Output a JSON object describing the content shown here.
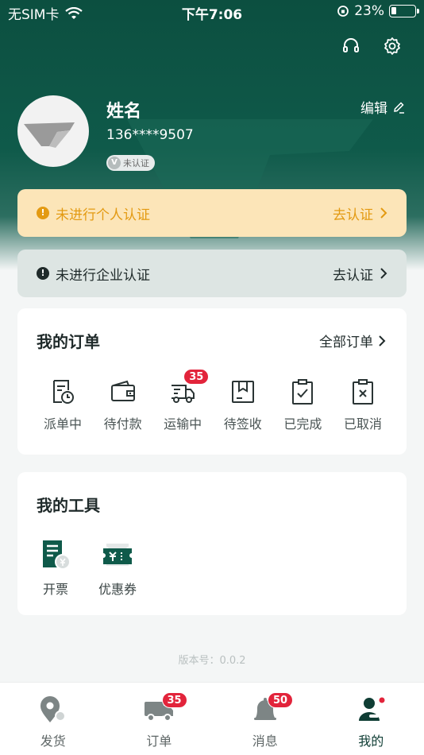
{
  "status_bar": {
    "carrier": "无SIM卡",
    "time": "下午7:06",
    "battery": "23%",
    "battery_level": 0.23
  },
  "profile": {
    "name": "姓名",
    "phone": "136****9507",
    "verify_badge_icon": "V",
    "verify_badge": "未认证",
    "edit_label": "编辑"
  },
  "notices": {
    "personal": {
      "icon": "!",
      "text": "未进行个人认证",
      "action": "去认证"
    },
    "company": {
      "icon": "!",
      "text": "未进行企业认证",
      "action": "去认证"
    }
  },
  "orders": {
    "title": "我的订单",
    "all_label": "全部订单",
    "items": [
      {
        "label": "派单中",
        "icon": "dispatch-icon"
      },
      {
        "label": "待付款",
        "icon": "wallet-icon"
      },
      {
        "label": "运输中",
        "icon": "truck-icon",
        "badge": "35"
      },
      {
        "label": "待签收",
        "icon": "package-icon"
      },
      {
        "label": "已完成",
        "icon": "clipboard-check-icon"
      },
      {
        "label": "已取消",
        "icon": "clipboard-cancel-icon"
      }
    ]
  },
  "tools": {
    "title": "我的工具",
    "items": [
      {
        "label": "开票",
        "icon": "invoice-icon"
      },
      {
        "label": "优惠券",
        "icon": "coupon-icon"
      }
    ]
  },
  "version": "版本号：0.0.2",
  "tabbar": [
    {
      "label": "发货",
      "icon": "location-pin-icon"
    },
    {
      "label": "订单",
      "icon": "truck-icon",
      "badge": "35"
    },
    {
      "label": "消息",
      "icon": "bell-icon",
      "badge": "50"
    },
    {
      "label": "我的",
      "icon": "profile-icon",
      "active": true
    }
  ],
  "colors": {
    "brand_green": "#0f5a4a",
    "warning": "#e39a12",
    "badge_red": "#e2243b"
  }
}
